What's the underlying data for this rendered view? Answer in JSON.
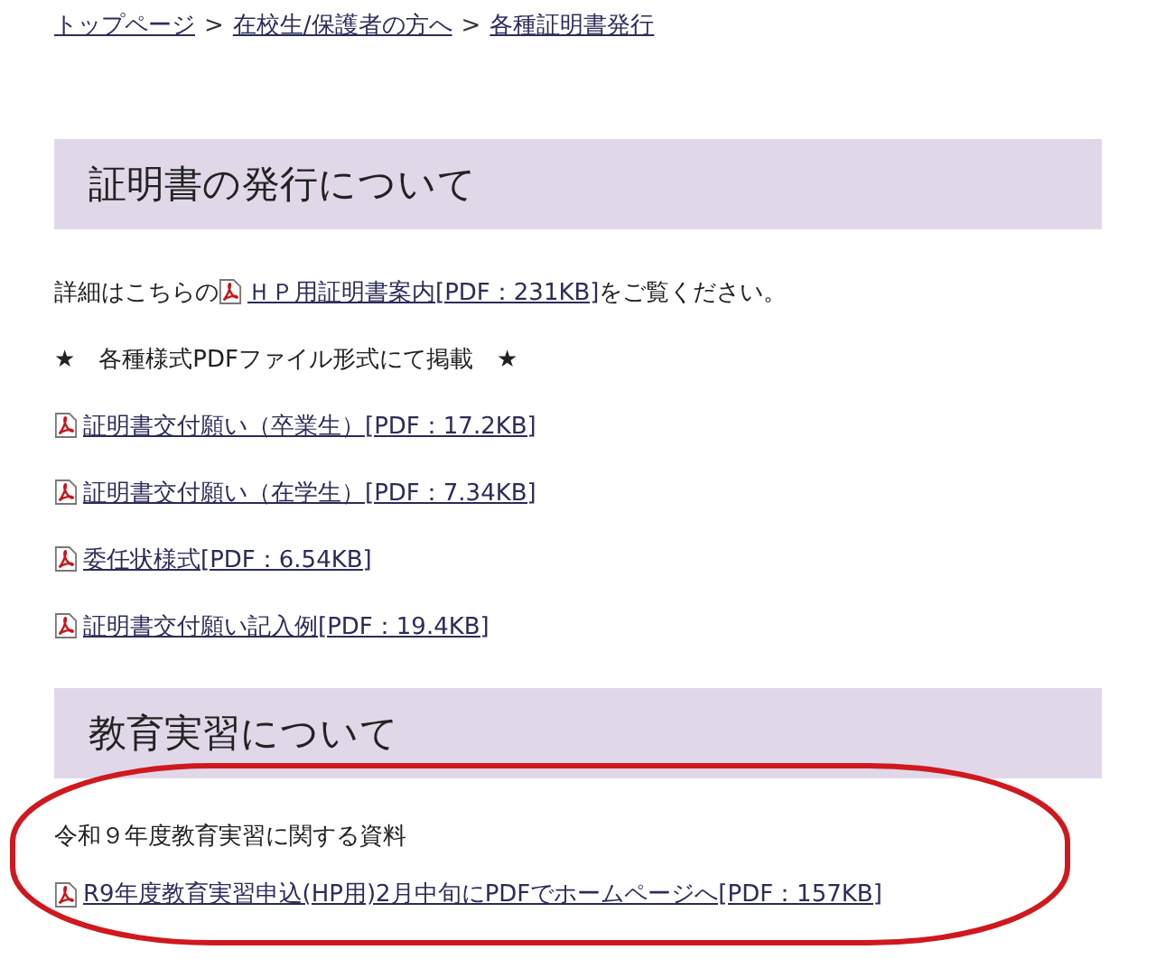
{
  "breadcrumb": {
    "separator": ">",
    "items": [
      {
        "label": "トップページ"
      },
      {
        "label": "在校生/保護者の方へ"
      },
      {
        "label": "各種証明書発行"
      }
    ]
  },
  "sections": [
    {
      "heading": "証明書の発行について",
      "blocks": [
        {
          "kind": "text-with-link",
          "before": "詳細はこちらの",
          "link": "ＨＰ用証明書案内[PDF：231KB]",
          "after": "をご覧ください。"
        },
        {
          "kind": "text",
          "text": "★　各種様式PDFファイル形式にて掲載　★"
        },
        {
          "kind": "pdf-link",
          "link": "証明書交付願い（卒業生）[PDF：17.2KB]"
        },
        {
          "kind": "pdf-link",
          "link": "証明書交付願い（在学生）[PDF：7.34KB]"
        },
        {
          "kind": "pdf-link",
          "link": "委任状様式[PDF：6.54KB]"
        },
        {
          "kind": "pdf-link",
          "link": "証明書交付願い記入例[PDF：19.4KB]"
        }
      ]
    },
    {
      "heading": "教育実習について",
      "highlighted": true,
      "blocks": [
        {
          "kind": "text",
          "text": "令和９年度教育実習に関する資料"
        },
        {
          "kind": "pdf-link",
          "link": "R9年度教育実習申込(HP用)2月中旬にPDFでホームページへ[PDF：157KB]"
        }
      ]
    }
  ]
}
